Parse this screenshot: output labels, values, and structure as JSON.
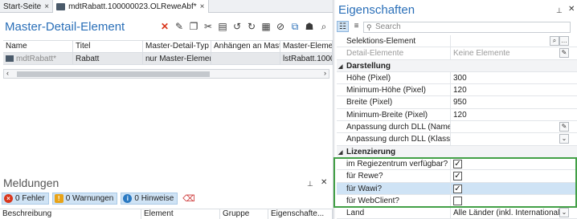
{
  "tabs": [
    {
      "label": "Start-Seite",
      "close": "×"
    },
    {
      "label": "mdtRabatt.100000023.OLReweAbf*",
      "close": "×"
    }
  ],
  "master_detail": {
    "title": "Master-Detail-Element",
    "columns": [
      "Name",
      "Titel",
      "Master-Detail-Typ",
      "Anhängen an Mast...",
      "Master-Eleme"
    ],
    "row": [
      "mdtRabatt*",
      "Rabatt",
      "nur Master-Element",
      "",
      "lstRabatt.1000"
    ]
  },
  "messages": {
    "title": "Meldungen",
    "filters": {
      "errors": "0 Fehler",
      "warnings": "0 Warnungen",
      "hints": "0 Hinweise"
    },
    "columns": [
      "Beschreibung",
      "Element",
      "Gruppe",
      "Eigenschafte..."
    ]
  },
  "properties": {
    "title": "Eigenschaften",
    "search_placeholder": "Search",
    "rows": {
      "selektion": {
        "name": "Selektions-Element",
        "value": ""
      },
      "detail": {
        "name": "Detail-Elemente",
        "value": "Keine Elemente"
      },
      "cat_darstellung": "Darstellung",
      "hoehe": {
        "name": "Höhe (Pixel)",
        "value": "300"
      },
      "min_hoehe": {
        "name": "Minimum-Höhe (Pixel)",
        "value": "120"
      },
      "breite": {
        "name": "Breite (Pixel)",
        "value": "950"
      },
      "min_breite": {
        "name": "Minimum-Breite (Pixel)",
        "value": "120"
      },
      "dll_name": {
        "name": "Anpassung durch DLL (Name)",
        "value": ""
      },
      "dll_klasse": {
        "name": "Anpassung durch DLL (Klassenn...",
        "value": ""
      },
      "cat_lizenz": "Lizenzierung",
      "regie": {
        "name": "im Regiezentrum verfügbar?",
        "checked": true
      },
      "rewe": {
        "name": "für Rewe?",
        "checked": true
      },
      "wawi": {
        "name": "für Wawi?",
        "checked": true
      },
      "webclient": {
        "name": "für WebClient?",
        "checked": false
      },
      "land": {
        "name": "Land",
        "value": "Alle Länder (inkl. International)"
      }
    }
  }
}
